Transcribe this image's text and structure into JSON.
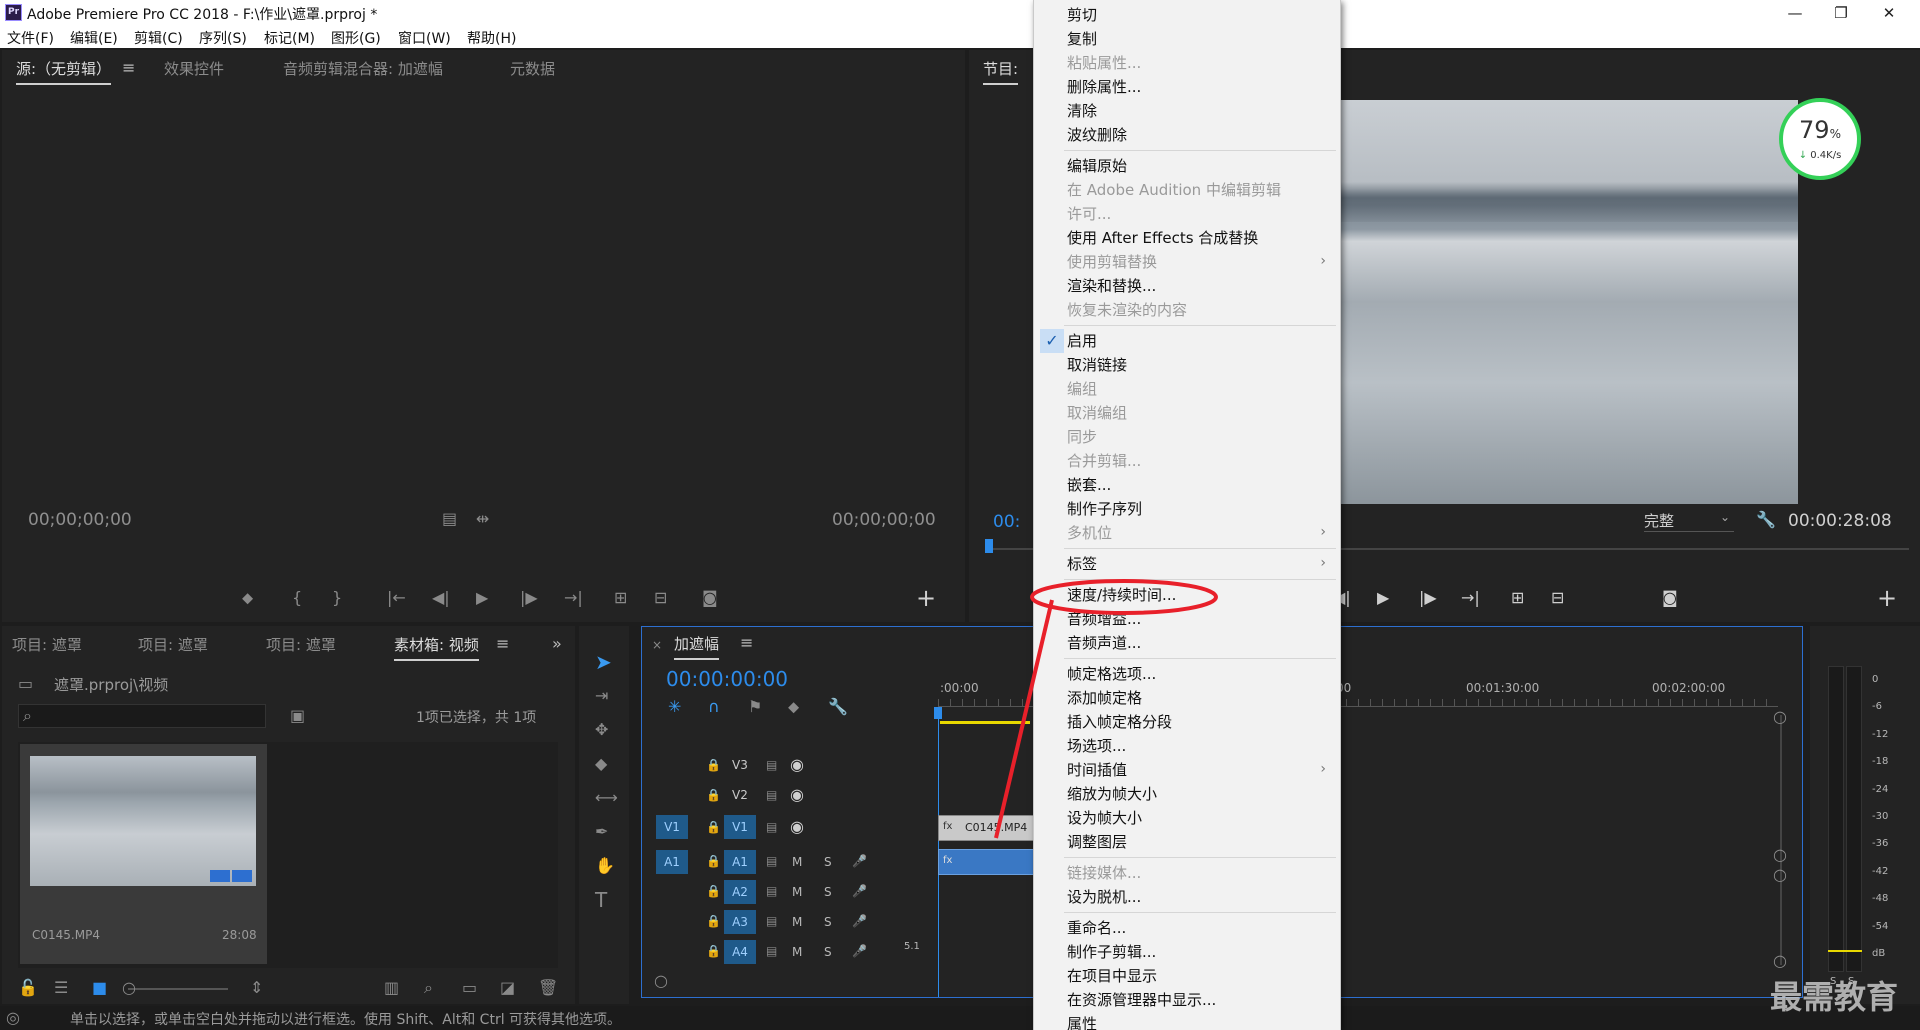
{
  "window": {
    "title": "Adobe Premiere Pro CC 2018 - F:\\作业\\遮罩.prproj *",
    "app_icon": "Pr",
    "controls": [
      "—",
      "❐",
      "✕"
    ]
  },
  "menubar": [
    "文件(F)",
    "编辑(E)",
    "剪辑(C)",
    "序列(S)",
    "标记(M)",
    "图形(G)",
    "窗口(W)",
    "帮助(H)"
  ],
  "source_panel": {
    "tabs": [
      "源:（无剪辑）",
      "效果控件",
      "音频剪辑混合器: 加遮幅",
      "元数据"
    ],
    "timecode_left": "00;00;00;00",
    "timecode_right": "00;00;00;00"
  },
  "program_panel": {
    "tab": "节目: ",
    "timecode_left": "00:",
    "quality": "完整",
    "timecode_right": "00:00:28:08",
    "net_badge": {
      "percent": "79",
      "unit": "%",
      "speed": "0.4K/s"
    }
  },
  "project_panel": {
    "tabs": [
      "项目: 遮罩",
      "项目: 遮罩",
      "项目: 遮罩",
      "素材箱: 视频"
    ],
    "path": "遮罩.prproj\\视频",
    "selection_status": "1项已选择，共 1项",
    "clip": {
      "name": "C0145.MP4",
      "duration": "28:08"
    }
  },
  "timeline": {
    "tab": "加遮幅",
    "timecode": "00:00:00:00",
    "ruler_labels": [
      ":00:00",
      ":00",
      "00:01:30:00",
      "00:02:00:00"
    ],
    "video_tracks": [
      "V3",
      "V2",
      "V1"
    ],
    "audio_tracks": [
      "A1",
      "A2",
      "A3",
      "A4"
    ],
    "source_v": "V1",
    "source_a": "A1",
    "clip_label": "C0145.MP4",
    "audio_channel": "5.1",
    "mute": "M",
    "solo": "S"
  },
  "meter": {
    "labels": [
      "0",
      "-6",
      "-12",
      "-18",
      "-24",
      "-30",
      "-36",
      "-42",
      "-48",
      "-54",
      "dB"
    ],
    "solo": [
      "S",
      "S"
    ]
  },
  "context_menu": {
    "items": [
      {
        "label": "剪切",
        "enabled": true
      },
      {
        "label": "复制",
        "enabled": true
      },
      {
        "label": "粘贴属性...",
        "enabled": false
      },
      {
        "label": "删除属性...",
        "enabled": true
      },
      {
        "label": "清除",
        "enabled": true
      },
      {
        "label": "波纹删除",
        "enabled": true
      },
      {
        "label": "编辑原始",
        "enabled": true
      },
      {
        "label": "在 Adobe Audition 中编辑剪辑",
        "enabled": false
      },
      {
        "label": "许可...",
        "enabled": false
      },
      {
        "label": "使用 After Effects 合成替换",
        "enabled": true
      },
      {
        "label": "使用剪辑替换",
        "enabled": false
      },
      {
        "label": "渲染和替换...",
        "enabled": true
      },
      {
        "label": "恢复未渲染的内容",
        "enabled": false
      },
      {
        "label": "启用",
        "enabled": true
      },
      {
        "label": "取消链接",
        "enabled": true
      },
      {
        "label": "编组",
        "enabled": false
      },
      {
        "label": "取消编组",
        "enabled": false
      },
      {
        "label": "同步",
        "enabled": false
      },
      {
        "label": "合并剪辑...",
        "enabled": false
      },
      {
        "label": "嵌套...",
        "enabled": true
      },
      {
        "label": "制作子序列",
        "enabled": true
      },
      {
        "label": "多机位",
        "enabled": false
      },
      {
        "label": "标签",
        "enabled": true
      },
      {
        "label": "速度/持续时间...",
        "enabled": true
      },
      {
        "label": "音频增益...",
        "enabled": true
      },
      {
        "label": "音频声道...",
        "enabled": true
      },
      {
        "label": "帧定格选项...",
        "enabled": true
      },
      {
        "label": "添加帧定格",
        "enabled": true
      },
      {
        "label": "插入帧定格分段",
        "enabled": true
      },
      {
        "label": "场选项...",
        "enabled": true
      },
      {
        "label": "时间插值",
        "enabled": true
      },
      {
        "label": "缩放为帧大小",
        "enabled": true
      },
      {
        "label": "设为帧大小",
        "enabled": true
      },
      {
        "label": "调整图层",
        "enabled": true
      },
      {
        "label": "链接媒体...",
        "enabled": false
      },
      {
        "label": "设为脱机...",
        "enabled": true
      },
      {
        "label": "重命名...",
        "enabled": true
      },
      {
        "label": "制作子剪辑...",
        "enabled": true
      },
      {
        "label": "在项目中显示",
        "enabled": true
      },
      {
        "label": "在资源管理器中显示...",
        "enabled": true
      },
      {
        "label": "属性",
        "enabled": true
      }
    ]
  },
  "status_bar": "单击以选择，或单击空白处并拖动以进行框选。使用 Shift、Alt和 Ctrl 可获得其他选项。",
  "watermark": "最需教育",
  "colors": {
    "accent_blue": "#2d8ceb",
    "annotation_red": "#e8202a",
    "timeline_yellow": "#e8d800"
  }
}
